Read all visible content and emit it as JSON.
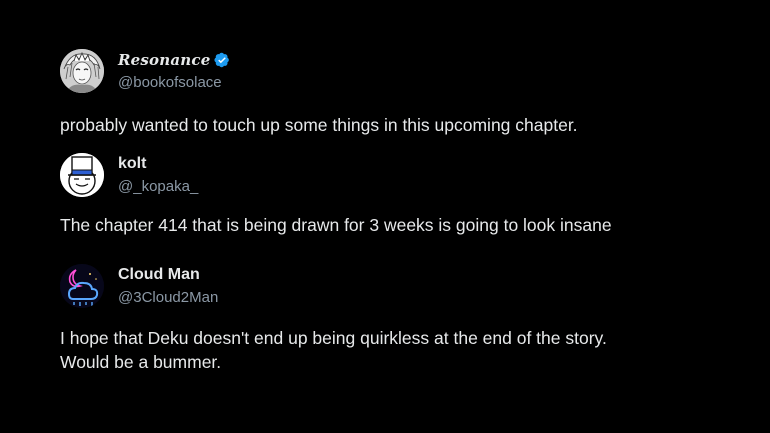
{
  "posts": [
    {
      "display_name": "Resonance",
      "handle": "@bookofsolace",
      "verified": true,
      "text": "probably wanted to touch up some things in this upcoming chapter."
    },
    {
      "display_name": "kolt",
      "handle": "@_kopaka_",
      "verified": false,
      "text": "The chapter 414 that is being drawn for 3 weeks is going to look insane"
    },
    {
      "display_name": "Cloud Man",
      "handle": "@3Cloud2Man",
      "verified": false,
      "text_lines": [
        "I hope that Deku doesn't end up being quirkless at the end of the story.",
        "Would be a bummer."
      ]
    }
  ],
  "colors": {
    "background": "#000000",
    "text": "#e7e9ea",
    "handle": "#8b98a5",
    "verified_badge": "#1d9bf0"
  },
  "icons": {
    "avatar_1": "manga-character-avatar",
    "avatar_2": "top-hat-cartoon-avatar",
    "avatar_3": "neon-cloud-moon-avatar",
    "verified": "verified-badge-icon"
  }
}
